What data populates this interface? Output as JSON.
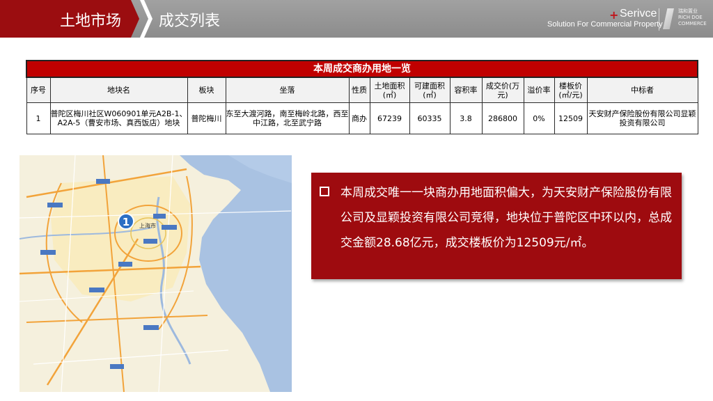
{
  "header": {
    "section_title": "土地市场",
    "page_title": "成交列表",
    "brand_name": "Serivce",
    "brand_tagline": "Solution For Commercial Property",
    "brand_cn": "瑞和置业 RICH DOE COMMERCE"
  },
  "table": {
    "title": "本周成交商办用地一览",
    "columns": [
      "序号",
      "地块名",
      "板块",
      "坐落",
      "性质",
      "土地面积(㎡)",
      "可建面积(㎡)",
      "容积率",
      "成交价(万元)",
      "溢价率",
      "楼板价(㎡/元)",
      "中标者"
    ],
    "rows": [
      {
        "index": "1",
        "name": "普陀区梅川社区W060901单元A2B-1、A2A-5（曹安市场、真西饭店）地块",
        "district": "普陀梅川",
        "location": "东至大渡河路，南至梅岭北路，西至中江路，北至武宁路",
        "type": "商办",
        "land_area": "67239",
        "buildable_area": "60335",
        "plot_ratio": "3.8",
        "price": "286800",
        "premium": "0%",
        "floor_price": "12509",
        "winner": "天安财产保险股份有限公司显颖投资有限公司"
      }
    ]
  },
  "map": {
    "marker_label": "1",
    "city_label": "上海市"
  },
  "note": {
    "bullet_icon": "hollow-square-bullet",
    "text": "本周成交唯一一块商办用地面积偏大，为天安财产保险股份有限公司及显颖投资有限公司竞得，地块位于普陀区中环以内，总成交金额28.68亿元，成交楼板价为12509元/㎡。"
  },
  "colors": {
    "accent_red": "#9e0b0f",
    "table_title_red": "#c00000",
    "header_gray": "#999999"
  }
}
